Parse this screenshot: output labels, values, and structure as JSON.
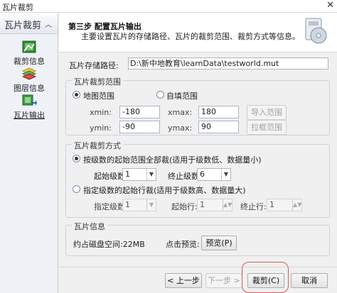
{
  "window": {
    "title": "瓦片裁剪",
    "close_glyph": "✕"
  },
  "sidebar": {
    "header": "瓦片裁剪",
    "items": [
      {
        "label": "裁剪信息",
        "icon": "crop-icon"
      },
      {
        "label": "图层信息",
        "icon": "layers-icon"
      },
      {
        "label": "瓦片输出",
        "icon": "tile-output-icon",
        "active": true
      }
    ]
  },
  "header": {
    "step": "第三步 配置瓦片输出",
    "description": "主要设置瓦片的存储路径、瓦片的裁剪范围、裁剪方式等信息。"
  },
  "path": {
    "label": "瓦片存储路径:",
    "value": "D:\\新中地教育\\learnData\\testworld.mut"
  },
  "range": {
    "title": "瓦片裁剪范围",
    "map_range_label": "地图范围",
    "custom_range_label": "自填范围",
    "selected": "map",
    "xmin_label": "xmin:",
    "xmin": "-180",
    "xmax_label": "xmax:",
    "xmax": "180",
    "ymin_label": "ymin:",
    "ymin": "-90",
    "ymax_label": "ymax:",
    "ymax": "90",
    "import_btn": "导入范围",
    "drag_btn": "拉框范围"
  },
  "mode": {
    "title": "瓦片裁剪方式",
    "by_level_label": "按级数的起始范围全部裁(适用于级数低、数据量小)",
    "by_row_label": "指定级数的起始行裁(适用于级数高、数据量大)",
    "selected": "by_level",
    "start_level_label": "起始级数:",
    "start_level": "1",
    "end_level_label": "终止级数:",
    "end_level": "6",
    "level_label": "指定级数:",
    "level": "1",
    "start_row_label": "起始行:",
    "start_row": "1",
    "end_row_label": "终止行:",
    "end_row": "1"
  },
  "info": {
    "title": "瓦片信息",
    "disk_label": "约占磁盘空间:22MB",
    "preview_prompt": "点击预览:",
    "preview_btn": "预览(P)"
  },
  "footer": {
    "prev_btn": "< 上一步",
    "next_btn": "下一步 >",
    "crop_btn": "裁剪(C)",
    "cancel_btn": "取消"
  },
  "colors": {
    "highlight_ring": "#d85a5a",
    "sidebar_bg": "#eef1f6"
  }
}
